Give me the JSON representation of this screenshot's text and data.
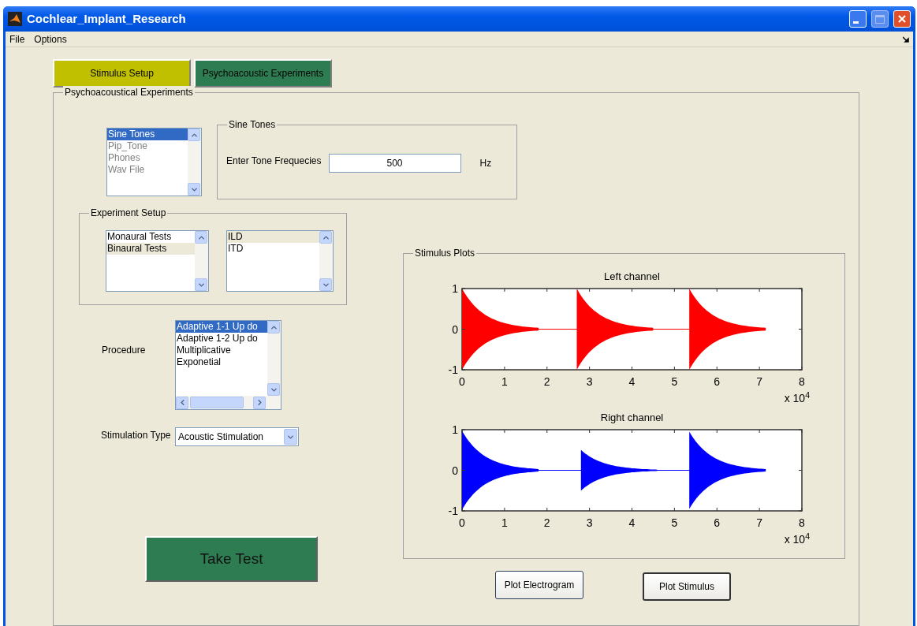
{
  "window": {
    "title": "Cochlear_Implant_Research"
  },
  "menu": [
    "File",
    "Options"
  ],
  "tabs": [
    {
      "label": "Stimulus Setup",
      "color": "#c0c000"
    },
    {
      "label": "Psychoacoustic Experiments",
      "color": "#2e7d52"
    }
  ],
  "panel": {
    "title": "Psychoacoustical Experiments"
  },
  "stimulus_list": {
    "focused": true,
    "items": [
      {
        "label": "Sine Tones",
        "selected": true,
        "disabled": false
      },
      {
        "label": "Pip_Tone",
        "selected": false,
        "disabled": true
      },
      {
        "label": "Phones",
        "selected": false,
        "disabled": true
      },
      {
        "label": "Wav File",
        "selected": false,
        "disabled": true
      }
    ]
  },
  "sine_tones": {
    "title": "Sine Tones",
    "label": "Enter Tone Frequecies",
    "value": "500",
    "unit": "Hz"
  },
  "experiment_setup": {
    "title": "Experiment Setup",
    "lists": [
      {
        "focused": false,
        "items": [
          {
            "label": "Monaural Tests",
            "selected": false,
            "disabled": false
          },
          {
            "label": "Binaural Tests",
            "selected": true,
            "disabled": false
          }
        ]
      },
      {
        "focused": false,
        "items": [
          {
            "label": "ILD",
            "selected": true,
            "disabled": false
          },
          {
            "label": "ITD",
            "selected": false,
            "disabled": false
          }
        ]
      }
    ]
  },
  "procedure": {
    "label": "Procedure",
    "list": {
      "focused": true,
      "items": [
        {
          "label": "Adaptive 1-1 Up do",
          "selected": true,
          "disabled": false
        },
        {
          "label": "Adaptive 1-2 Up do",
          "selected": false,
          "disabled": false
        },
        {
          "label": "Multiplicative",
          "selected": false,
          "disabled": false
        },
        {
          "label": "Exponetial",
          "selected": false,
          "disabled": false
        }
      ]
    }
  },
  "stimulation_type": {
    "label": "Stimulation Type",
    "value": "Acoustic Stimulation"
  },
  "take_test_button": "Take Test",
  "stimulus_plots": {
    "title": "Stimulus Plots",
    "plots": [
      {
        "title": "Left channel",
        "color": "#ff0000",
        "yticks": [
          "1",
          "0",
          "-1"
        ],
        "xticks": [
          "0",
          "1",
          "2",
          "3",
          "4",
          "5",
          "6",
          "7",
          "8"
        ],
        "multiplier": "x 10$^{4}$"
      },
      {
        "title": "Right channel",
        "color": "#0000ff",
        "yticks": [
          "1",
          "0",
          "-1"
        ],
        "xticks": [
          "0",
          "1",
          "2",
          "3",
          "4",
          "5",
          "6",
          "7",
          "8"
        ],
        "multiplier": "x 10$^{4}$"
      }
    ]
  },
  "buttons": [
    {
      "label": "Plot Electrogram",
      "focused": false
    },
    {
      "label": "Plot Stimulus",
      "focused": true
    }
  ]
}
